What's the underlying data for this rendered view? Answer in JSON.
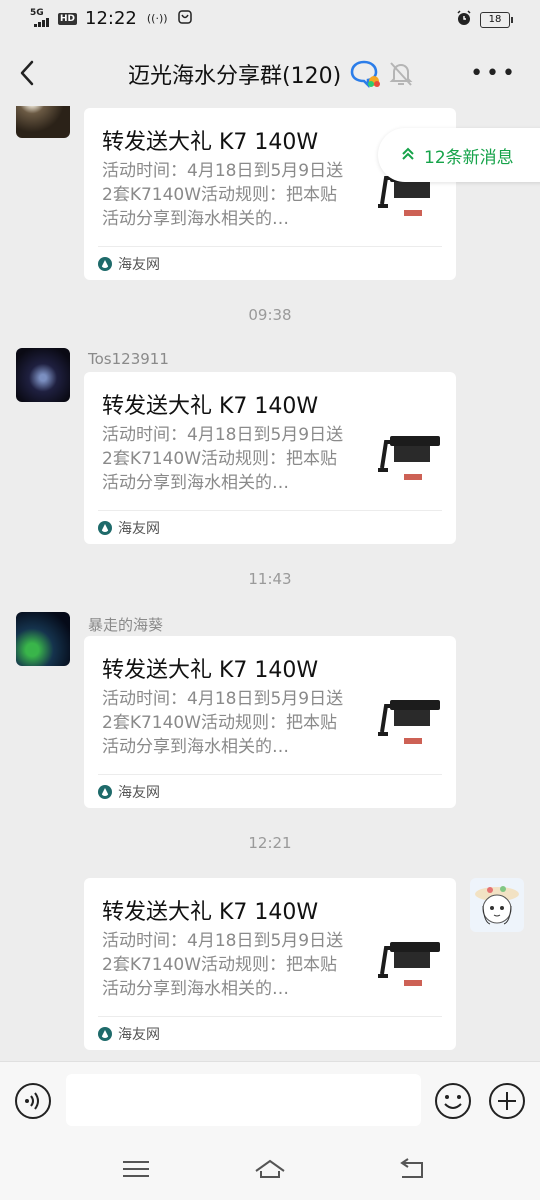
{
  "status_bar": {
    "network": "5G",
    "hd": "HD",
    "time": "12:22",
    "battery": "18"
  },
  "header": {
    "title": "迈光海水分享群(120)"
  },
  "new_messages": {
    "label": "12条新消息"
  },
  "messages": [
    {
      "sender": "",
      "title": "转发送大礼 K7 140W",
      "desc": "活动时间：4月18日到5月9日送2套K7140W活动规则：把本贴活动分享到海水相关的…",
      "source": "海友网"
    },
    {
      "sender": "Tos123911",
      "title": "转发送大礼 K7 140W",
      "desc": "活动时间：4月18日到5月9日送2套K7140W活动规则：把本贴活动分享到海水相关的…",
      "source": "海友网"
    },
    {
      "sender": "暴走的海葵",
      "title": "转发送大礼 K7 140W",
      "desc": "活动时间：4月18日到5月9日送2套K7140W活动规则：把本贴活动分享到海水相关的…",
      "source": "海友网"
    },
    {
      "sender": "",
      "title": "转发送大礼 K7 140W",
      "desc": "活动时间：4月18日到5月9日送2套K7140W活动规则：把本贴活动分享到海水相关的…",
      "source": "海友网"
    }
  ],
  "timestamps": [
    "09:38",
    "11:43",
    "12:21"
  ],
  "input": {
    "value": ""
  },
  "colors": {
    "accent_green": "#16a34a",
    "chat_bg": "#ededed"
  },
  "icons": [
    "back-arrow-icon",
    "chat-bubble-badge-icon",
    "bell-muted-icon",
    "more-icon",
    "voice-icon",
    "emoji-icon",
    "plus-icon",
    "menu-icon",
    "home-icon",
    "back-nav-icon"
  ]
}
